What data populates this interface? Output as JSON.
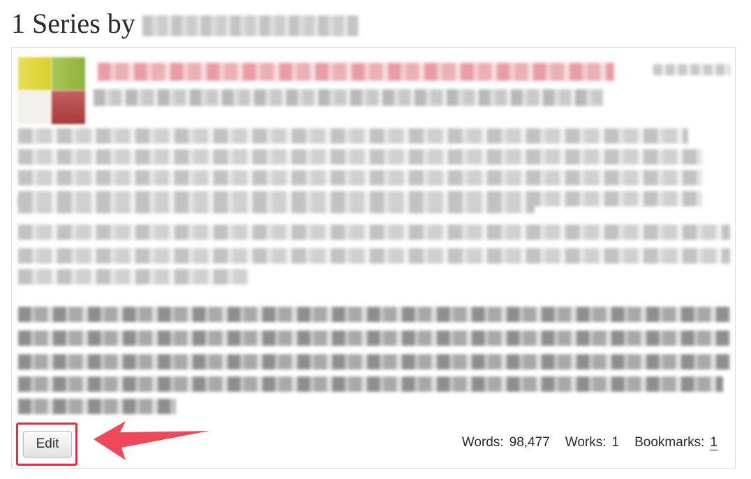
{
  "heading": {
    "prefix": "1 Series by"
  },
  "actions": {
    "edit_label": "Edit"
  },
  "stats": {
    "words_label": "Words:",
    "words_value": "98,477",
    "works_label": "Works:",
    "works_value": "1",
    "bookmarks_label": "Bookmarks:",
    "bookmarks_value": "1"
  },
  "colors": {
    "highlight_box": "#ee2b3a",
    "arrow": "#f0475a",
    "card_border": "#dcdcdc"
  },
  "icons": [
    "series-icon",
    "arrow-annotation"
  ]
}
